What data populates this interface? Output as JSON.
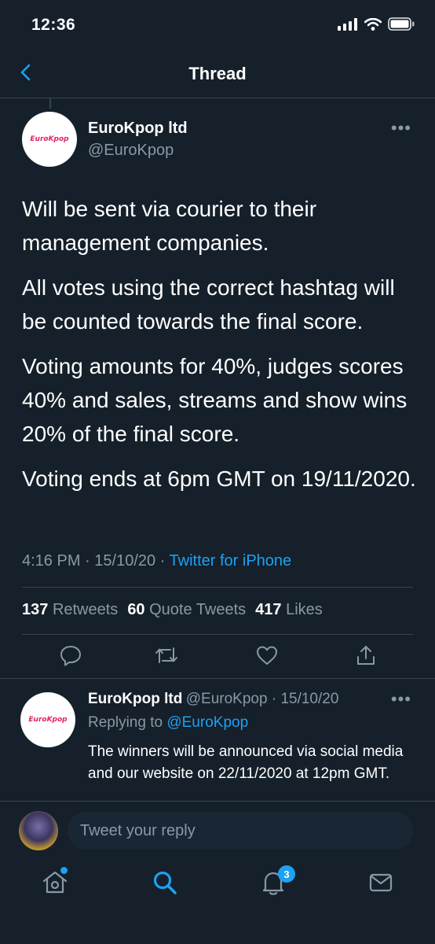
{
  "status": {
    "time": "12:36"
  },
  "nav": {
    "title": "Thread"
  },
  "tweet": {
    "author_name": "EuroKpop ltd",
    "author_handle": "@EuroKpop",
    "avatar_logo": "EuroKpop",
    "paragraphs": [
      "Will be sent via courier to their management companies.",
      "All votes using the correct hashtag will be counted towards the final score.",
      "Voting amounts for 40%, judges scores 40% and sales, streams and show wins 20% of the final score.",
      "Voting ends at 6pm GMT on 19/11/2020."
    ],
    "time": "4:16 PM",
    "date": "15/10/20",
    "source": "Twitter for iPhone",
    "retweets_count": "137",
    "retweets_label": "Retweets",
    "quotes_count": "60",
    "quotes_label": "Quote Tweets",
    "likes_count": "417",
    "likes_label": "Likes"
  },
  "reply": {
    "author_name": "EuroKpop ltd",
    "author_handle": "@EuroKpop",
    "date": "15/10/20",
    "replying_label": "Replying to",
    "replying_handle": "@EuroKpop",
    "text": "The winners will be announced via social media and our website on 22/11/2020 at 12pm GMT."
  },
  "compose": {
    "placeholder": "Tweet your reply"
  },
  "tabbar": {
    "notifications_badge": "3"
  },
  "colors": {
    "background": "#15202b",
    "accent": "#1da1f2",
    "muted": "#8899a6",
    "divider": "#38444d"
  },
  "icons": [
    "back-chevron-icon",
    "more-icon",
    "reply-icon",
    "retweet-icon",
    "like-icon",
    "share-icon",
    "home-icon",
    "search-icon",
    "notifications-icon",
    "messages-icon",
    "signal-icon",
    "wifi-icon",
    "battery-icon"
  ]
}
